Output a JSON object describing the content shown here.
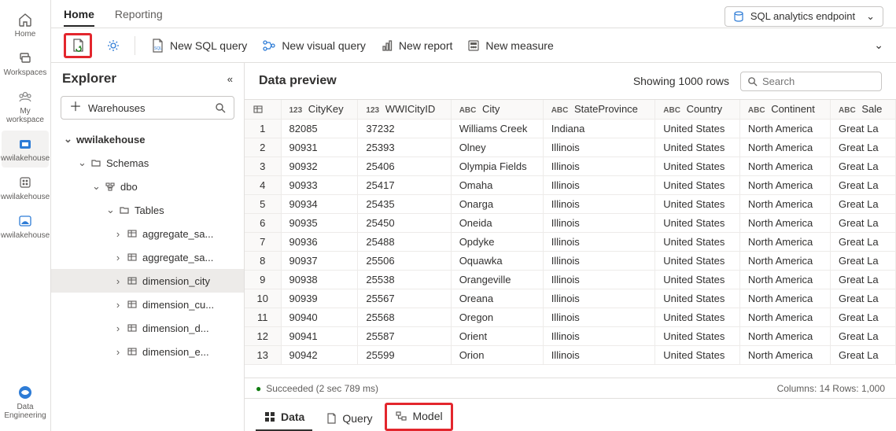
{
  "leftrail": {
    "items": [
      {
        "label": "Home"
      },
      {
        "label": "Workspaces"
      },
      {
        "label": "My workspace"
      },
      {
        "label": "wwilakehouse"
      },
      {
        "label": "wwilakehouse"
      },
      {
        "label": "wwilakehouse"
      }
    ],
    "bottom": {
      "label": "Data Engineering"
    }
  },
  "pivots": {
    "home": "Home",
    "reporting": "Reporting"
  },
  "endpoint_dropdown": "SQL analytics endpoint",
  "toolbar": {
    "new_sql": "New SQL query",
    "new_visual": "New visual query",
    "new_report": "New report",
    "new_measure": "New measure"
  },
  "explorer": {
    "title": "Explorer",
    "warehouses_btn": "Warehouses",
    "tree": {
      "root": "wwilakehouse",
      "schemas": "Schemas",
      "dbo": "dbo",
      "tables": "Tables",
      "table_items": [
        "aggregate_sa...",
        "aggregate_sa...",
        "dimension_city",
        "dimension_cu...",
        "dimension_d...",
        "dimension_e..."
      ]
    }
  },
  "preview": {
    "title": "Data preview",
    "showing": "Showing 1000 rows",
    "search_placeholder": "Search",
    "columns": [
      {
        "type": "123",
        "name": "CityKey"
      },
      {
        "type": "123",
        "name": "WWICityID"
      },
      {
        "type": "ABC",
        "name": "City"
      },
      {
        "type": "ABC",
        "name": "StateProvince"
      },
      {
        "type": "ABC",
        "name": "Country"
      },
      {
        "type": "ABC",
        "name": "Continent"
      },
      {
        "type": "ABC",
        "name": "Sale"
      }
    ],
    "rows": [
      [
        "82085",
        "37232",
        "Williams Creek",
        "Indiana",
        "United States",
        "North America",
        "Great La"
      ],
      [
        "90931",
        "25393",
        "Olney",
        "Illinois",
        "United States",
        "North America",
        "Great La"
      ],
      [
        "90932",
        "25406",
        "Olympia Fields",
        "Illinois",
        "United States",
        "North America",
        "Great La"
      ],
      [
        "90933",
        "25417",
        "Omaha",
        "Illinois",
        "United States",
        "North America",
        "Great La"
      ],
      [
        "90934",
        "25435",
        "Onarga",
        "Illinois",
        "United States",
        "North America",
        "Great La"
      ],
      [
        "90935",
        "25450",
        "Oneida",
        "Illinois",
        "United States",
        "North America",
        "Great La"
      ],
      [
        "90936",
        "25488",
        "Opdyke",
        "Illinois",
        "United States",
        "North America",
        "Great La"
      ],
      [
        "90937",
        "25506",
        "Oquawka",
        "Illinois",
        "United States",
        "North America",
        "Great La"
      ],
      [
        "90938",
        "25538",
        "Orangeville",
        "Illinois",
        "United States",
        "North America",
        "Great La"
      ],
      [
        "90939",
        "25567",
        "Oreana",
        "Illinois",
        "United States",
        "North America",
        "Great La"
      ],
      [
        "90940",
        "25568",
        "Oregon",
        "Illinois",
        "United States",
        "North America",
        "Great La"
      ],
      [
        "90941",
        "25587",
        "Orient",
        "Illinois",
        "United States",
        "North America",
        "Great La"
      ],
      [
        "90942",
        "25599",
        "Orion",
        "Illinois",
        "United States",
        "North America",
        "Great La"
      ]
    ],
    "status_text": "Succeeded (2 sec 789 ms)",
    "status_right": "Columns: 14  Rows: 1,000"
  },
  "bottom_tabs": {
    "data": "Data",
    "query": "Query",
    "model": "Model"
  }
}
